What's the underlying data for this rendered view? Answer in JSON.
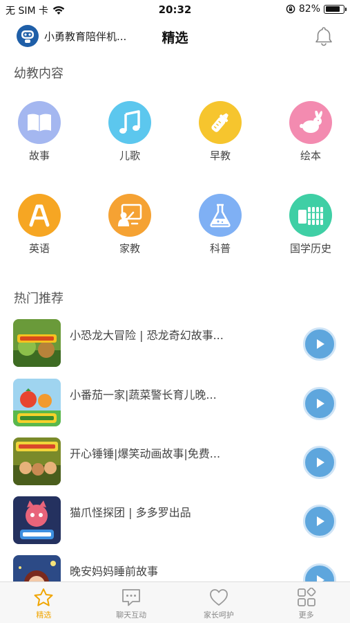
{
  "status_bar": {
    "carrier": "无 SIM 卡",
    "time": "20:32",
    "battery": "82%",
    "battery_level": 0.82
  },
  "nav": {
    "app_name": "小勇教育陪伴机...",
    "title": "精选"
  },
  "sections": {
    "kids_content": "幼教内容",
    "hot": "热门推荐"
  },
  "categories": [
    {
      "label": "故事",
      "icon": "book-icon",
      "color": "#a4b7f0"
    },
    {
      "label": "儿歌",
      "icon": "music-note-icon",
      "color": "#5cc7ee"
    },
    {
      "label": "早教",
      "icon": "baby-bottle-icon",
      "color": "#f6c52e"
    },
    {
      "label": "绘本",
      "icon": "rabbit-icon",
      "color": "#f38bb0"
    },
    {
      "label": "英语",
      "icon": "letter-a-icon",
      "color": "#f6a623"
    },
    {
      "label": "家教",
      "icon": "teacher-board-icon",
      "color": "#f5a233"
    },
    {
      "label": "科普",
      "icon": "flask-icon",
      "color": "#7fb0f4"
    },
    {
      "label": "国学历史",
      "icon": "bamboo-scroll-icon",
      "color": "#3fcfa5"
    }
  ],
  "recommendations": [
    {
      "title": "小恐龙大冒险 | 恐龙奇幻故事..."
    },
    {
      "title": "小番茄一家|蔬菜警长育儿晚..."
    },
    {
      "title": "开心锤锤|爆笑动画故事|免费..."
    },
    {
      "title": "猫爪怪探团 | 多多罗出品"
    },
    {
      "title": "晚安妈妈睡前故事"
    }
  ],
  "tabs": [
    {
      "label": "精选",
      "icon": "star-icon",
      "active": true
    },
    {
      "label": "聊天互动",
      "icon": "chat-icon",
      "active": false
    },
    {
      "label": "家长呵护",
      "icon": "heart-icon",
      "active": false
    },
    {
      "label": "更多",
      "icon": "grid-icon",
      "active": false
    }
  ],
  "colors": {
    "accent": "#f0a500",
    "play_button": "#5ea6dd"
  }
}
